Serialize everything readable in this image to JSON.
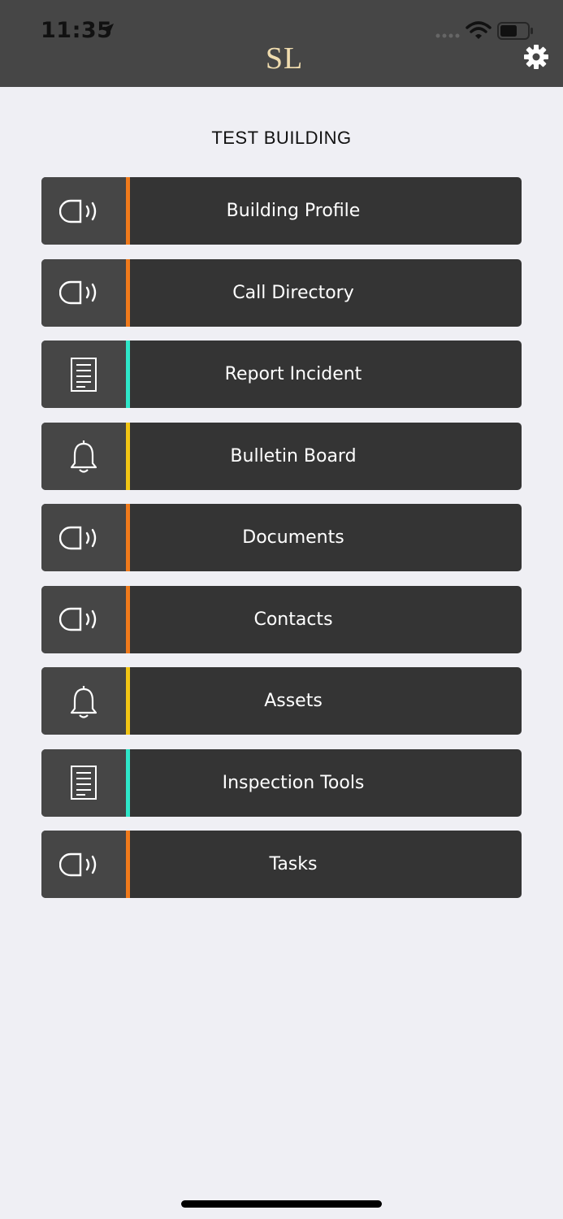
{
  "status_bar": {
    "time": "11:35"
  },
  "header": {
    "logo": "SL"
  },
  "page": {
    "title": "TEST BUILDING"
  },
  "colors": {
    "orange": "#f07a1b",
    "teal": "#2ee6c8",
    "yellow": "#f2c514"
  },
  "menu": [
    {
      "label": "Building Profile",
      "icon": "speaker-icon",
      "accent": "#f07a1b"
    },
    {
      "label": "Call Directory",
      "icon": "speaker-icon",
      "accent": "#f07a1b"
    },
    {
      "label": "Report Incident",
      "icon": "document-icon",
      "accent": "#2ee6c8"
    },
    {
      "label": "Bulletin Board",
      "icon": "bell-icon",
      "accent": "#f2c514"
    },
    {
      "label": "Documents",
      "icon": "speaker-icon",
      "accent": "#f07a1b"
    },
    {
      "label": "Contacts",
      "icon": "speaker-icon",
      "accent": "#f07a1b"
    },
    {
      "label": "Assets",
      "icon": "bell-icon",
      "accent": "#f2c514"
    },
    {
      "label": "Inspection Tools",
      "icon": "document-icon",
      "accent": "#2ee6c8"
    },
    {
      "label": "Tasks",
      "icon": "speaker-icon",
      "accent": "#f07a1b"
    }
  ]
}
